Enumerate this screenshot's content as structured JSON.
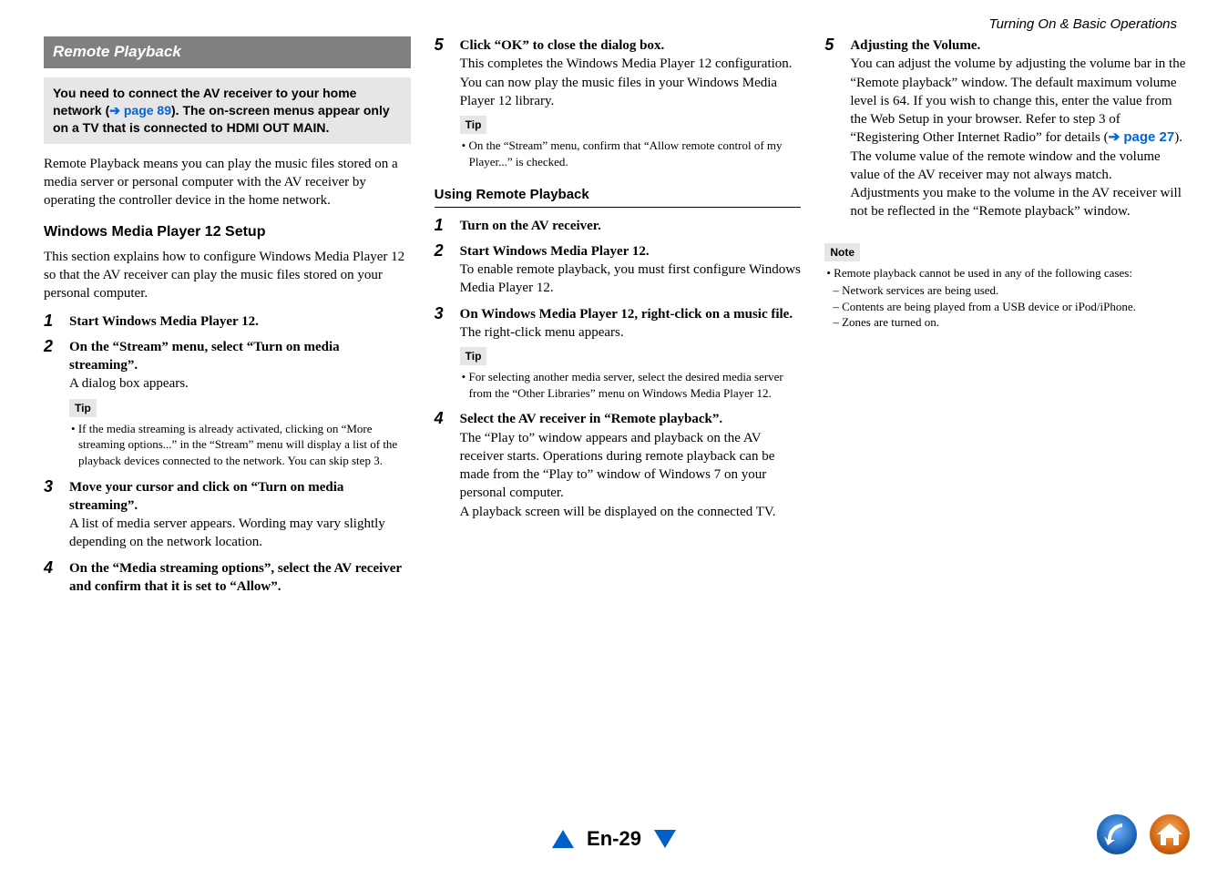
{
  "header": {
    "chapter": "Turning On & Basic Operations"
  },
  "col1": {
    "section_title": "Remote Playback",
    "notice_pre": "You need to connect the AV receiver to your home network (",
    "notice_link": "➔ page 89",
    "notice_post": "). The on-screen menus appear only on a TV that is connected to ",
    "notice_bold_end": "HDMI OUT MAIN.",
    "intro": "Remote Playback means you can play the music files stored on a media server or personal computer with the AV receiver by operating the controller device in the home network.",
    "h2": "Windows Media Player 12 Setup",
    "h2_desc": "This section explains how to configure Windows Media Player 12 so that the AV receiver can play the music files stored on your personal computer.",
    "steps": [
      {
        "n": "1",
        "title": "Start Windows Media Player 12."
      },
      {
        "n": "2",
        "title": "On the “Stream” menu, select “Turn on media streaming”.",
        "text": "A dialog box appears.",
        "tip_label": "Tip",
        "tip": "If the media streaming is already activated, clicking on “More streaming options...” in the “Stream” menu will display a list of the playback devices connected to the network. You can skip step 3."
      },
      {
        "n": "3",
        "title": "Move your cursor and click on “Turn on media streaming”.",
        "text": "A list of media server appears. Wording may vary slightly depending on the network location."
      },
      {
        "n": "4",
        "title": "On the “Media streaming options”, select the AV receiver and confirm that it is set to “Allow”."
      }
    ]
  },
  "col2": {
    "step5": {
      "n": "5",
      "title": "Click “OK” to close the dialog box.",
      "text1": "This completes the Windows Media Player 12 configuration.",
      "text2": "You can now play the music files in your Windows Media Player 12 library.",
      "tip_label": "Tip",
      "tip": "On the “Stream” menu, confirm that “Allow remote control of my Player...” is checked."
    },
    "h3": "Using Remote Playback",
    "steps": [
      {
        "n": "1",
        "title": "Turn on the AV receiver."
      },
      {
        "n": "2",
        "title": "Start Windows Media Player 12.",
        "text": "To enable remote playback, you must first configure Windows Media Player 12."
      },
      {
        "n": "3",
        "title": "On Windows Media Player 12, right-click on a music file.",
        "text": "The right-click menu appears.",
        "tip_label": "Tip",
        "tip": "For selecting another media server, select the desired media server from the “Other Libraries” menu on Windows Media Player 12."
      },
      {
        "n": "4",
        "title": "Select the AV receiver in “Remote playback”.",
        "text": "The “Play to” window appears and playback on the AV receiver starts. Operations during remote playback can be made from the “Play to” window of Windows 7 on your personal computer.",
        "text2": "A playback screen will be displayed on the connected TV."
      }
    ]
  },
  "col3": {
    "step5": {
      "n": "5",
      "title": "Adjusting the Volume.",
      "text1_pre": "You can adjust the volume by adjusting the volume bar in the “Remote playback” window. The default maximum volume level is 64. If you wish to change this, enter the value from the Web Setup in your browser. Refer to step 3 of “Registering Other Internet Radio” for details (",
      "text1_link": "➔ page 27",
      "text1_post": ").",
      "text2": "The volume value of the remote window and the volume value of the AV receiver may not always match.",
      "text3": "Adjustments you make to the volume in the AV receiver will not be reflected in the “Remote playback” window."
    },
    "note_label": "Note",
    "note_lead": "Remote playback cannot be used in any of the following cases:",
    "note_items": [
      "Network services are being used.",
      "Contents are being played from a USB device or iPod/iPhone.",
      "Zones are turned on."
    ]
  },
  "footer": {
    "page": "En-29"
  }
}
